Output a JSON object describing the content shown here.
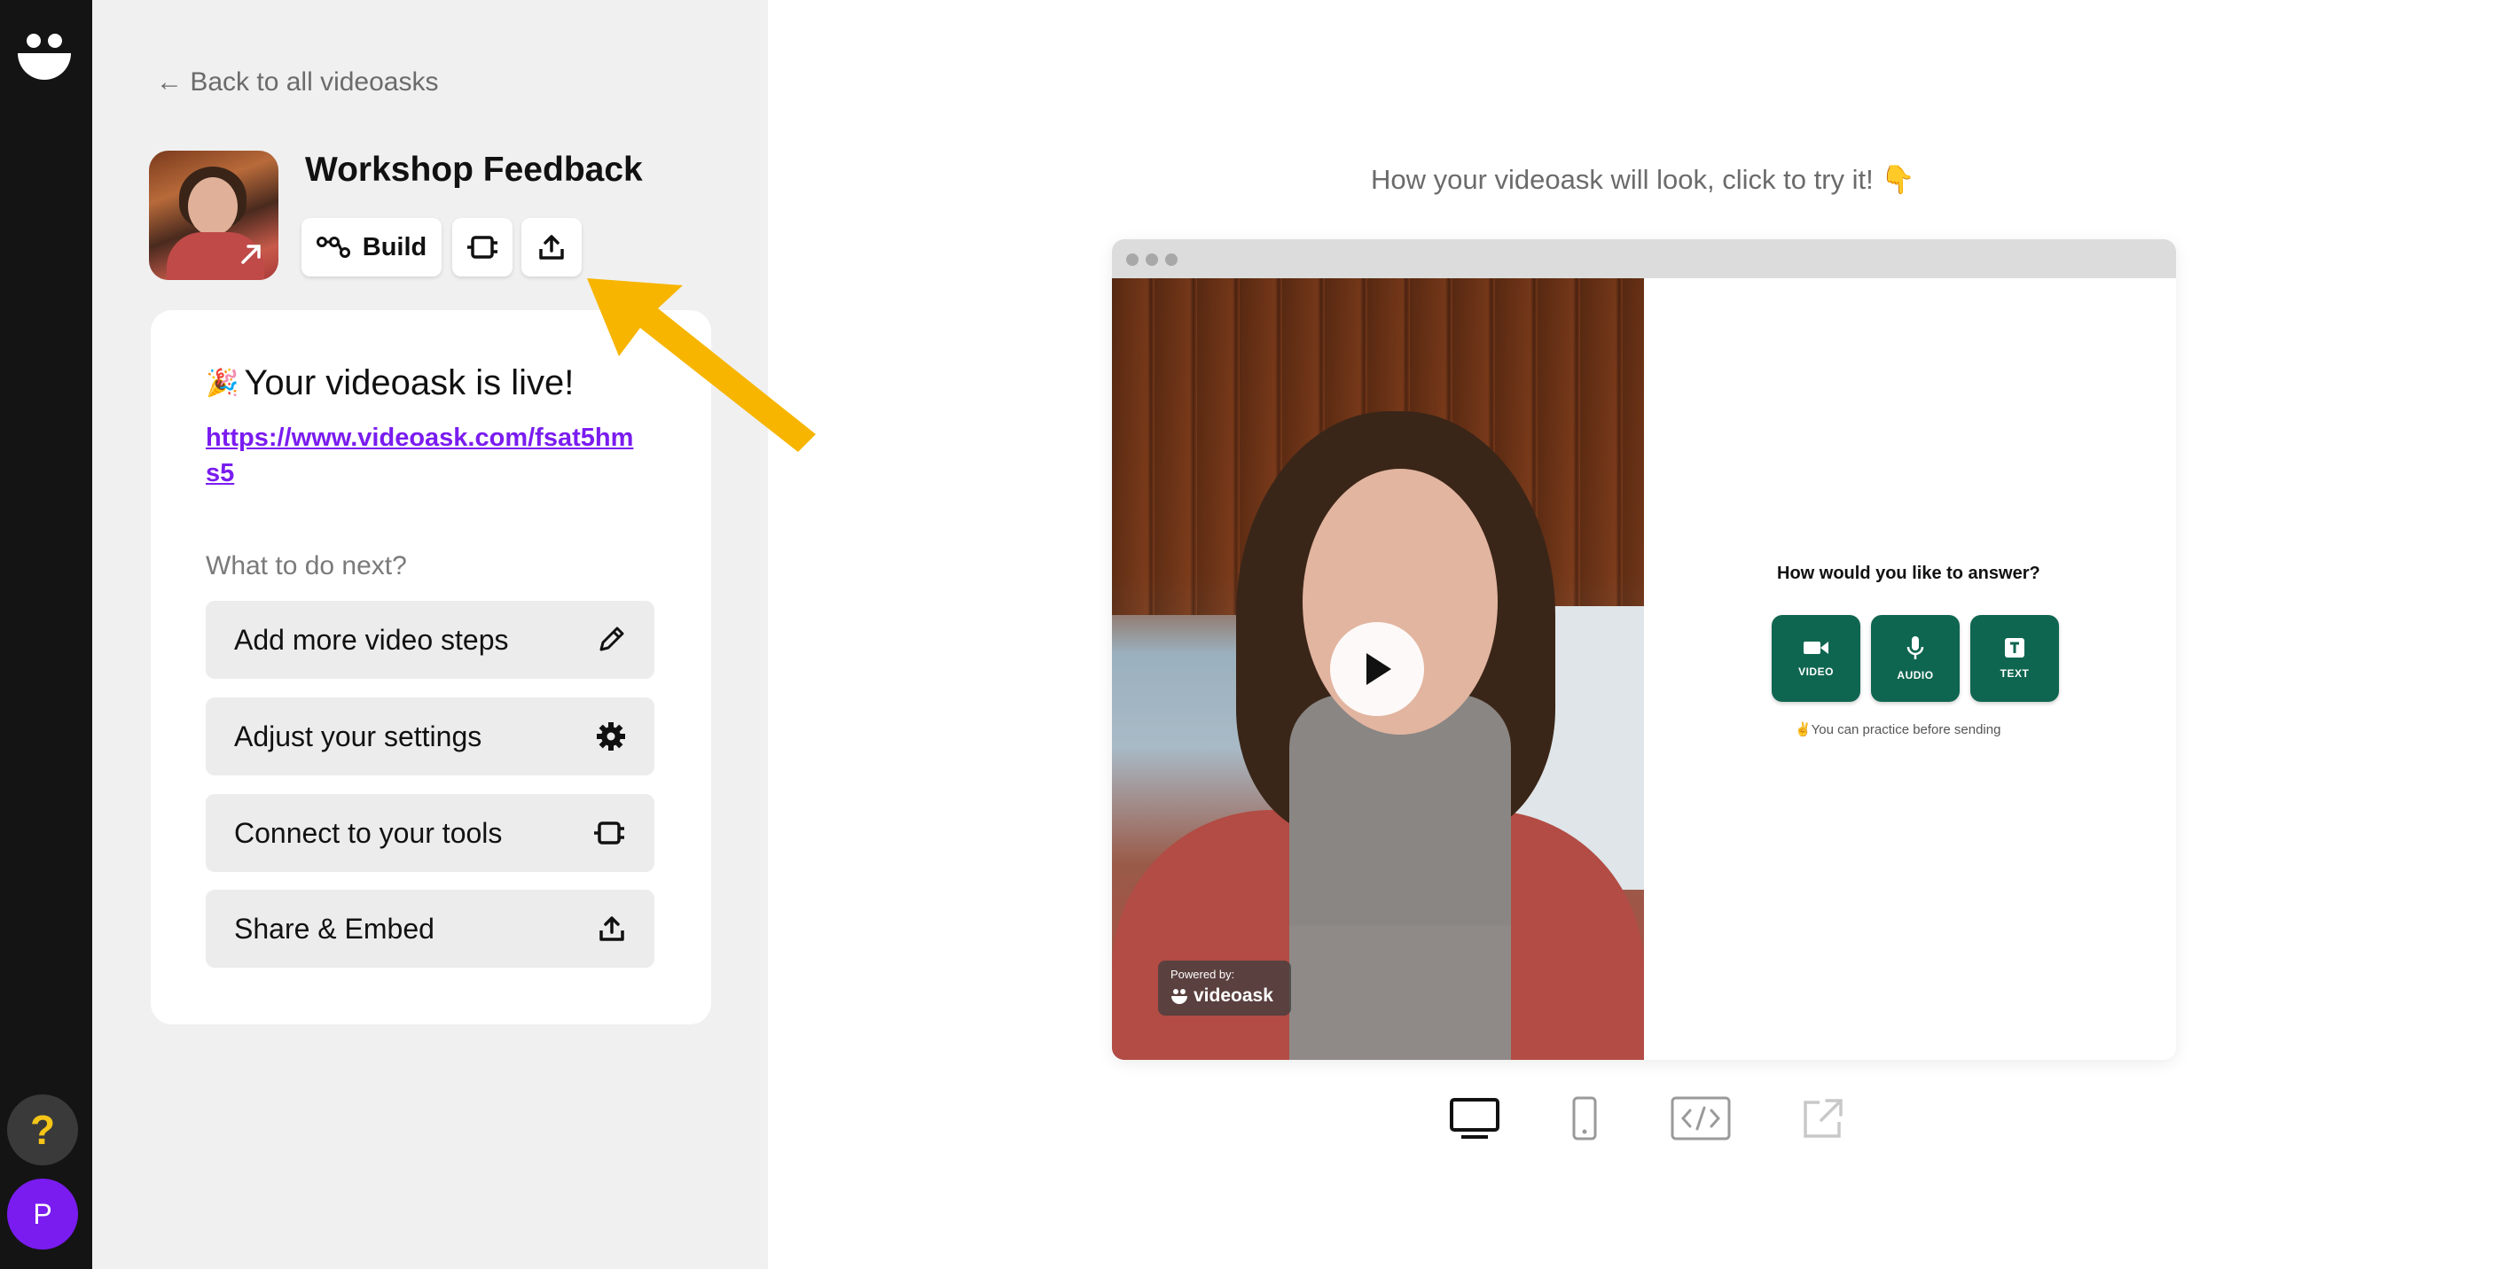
{
  "nav": {
    "back_label": "← Back to all videoasks",
    "help_label": "?",
    "avatar_initial": "P"
  },
  "videoask": {
    "title": "Workshop Feedback",
    "build_label": "Build"
  },
  "card": {
    "live_emoji": "🎉",
    "live_heading": "Your videoask is live!",
    "link": "https://www.videoask.com/fsat5hms5",
    "next_heading": "What to do next?",
    "actions": [
      {
        "label": "Add more video steps",
        "icon": "pencil-icon"
      },
      {
        "label": "Adjust your settings",
        "icon": "gear-icon"
      },
      {
        "label": "Connect to your tools",
        "icon": "connect-icon"
      },
      {
        "label": "Share & Embed",
        "icon": "share-icon"
      }
    ]
  },
  "preview": {
    "hint": "How your videoask will look, click to try it! 👇",
    "question": "How would you like to answer?",
    "answer_options": [
      "VIDEO",
      "AUDIO",
      "TEXT"
    ],
    "practice_note": "✌️You can practice before sending",
    "powered_by": "Powered by:",
    "brand": "videoask"
  },
  "device_toggle": {
    "options": [
      "desktop-icon",
      "mobile-icon",
      "embed-code-icon",
      "external-link-icon"
    ],
    "selected": "desktop-icon"
  },
  "colors": {
    "accent_purple": "#7a1cf0",
    "answer_green": "#0f6650",
    "pointer_yellow": "#f7b500",
    "rail_dark": "#141414"
  }
}
